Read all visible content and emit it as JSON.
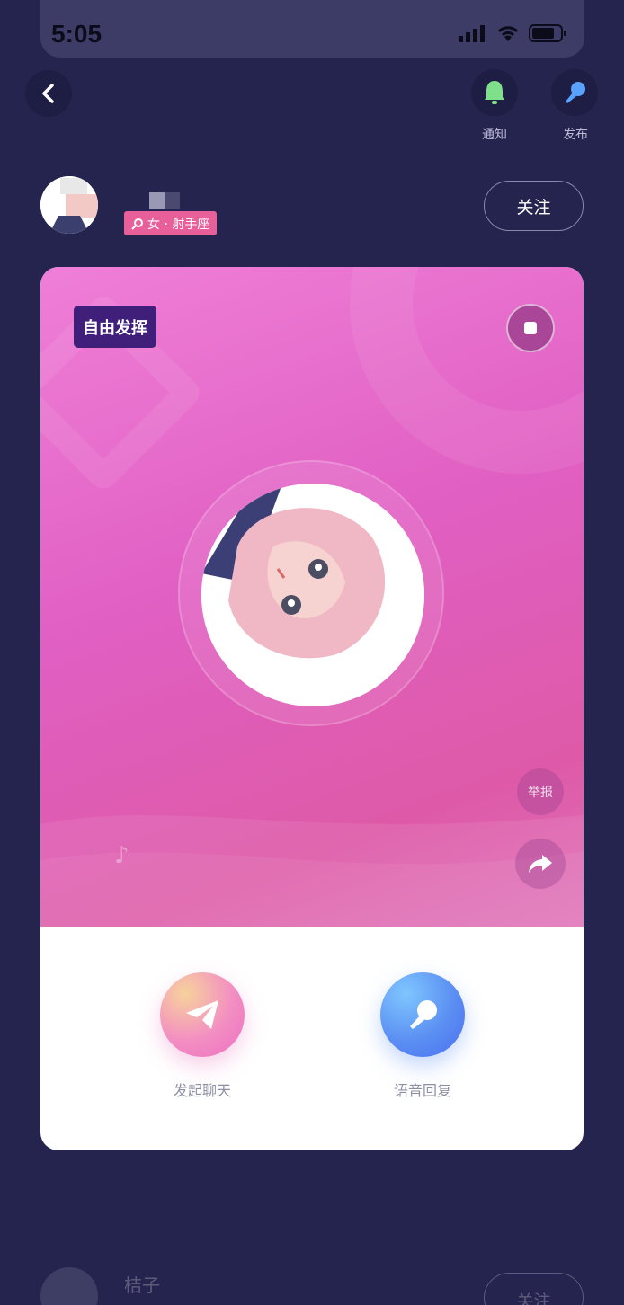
{
  "status_bar": {
    "time": "5:05"
  },
  "header": {
    "notify_label": "通知",
    "publish_label": "发布",
    "accent_colors": {
      "notify": "#7fe08a",
      "publish": "#5aa2ff"
    }
  },
  "profile": {
    "tag": "女 · 射手座",
    "follow_label": "关注"
  },
  "card": {
    "mode_badge": "自由发挥",
    "report_label": "举报",
    "chat_label": "发起聊天",
    "voice_reply_label": "语音回复"
  },
  "next_item": {
    "name": "桔子",
    "follow_label": "关注"
  }
}
